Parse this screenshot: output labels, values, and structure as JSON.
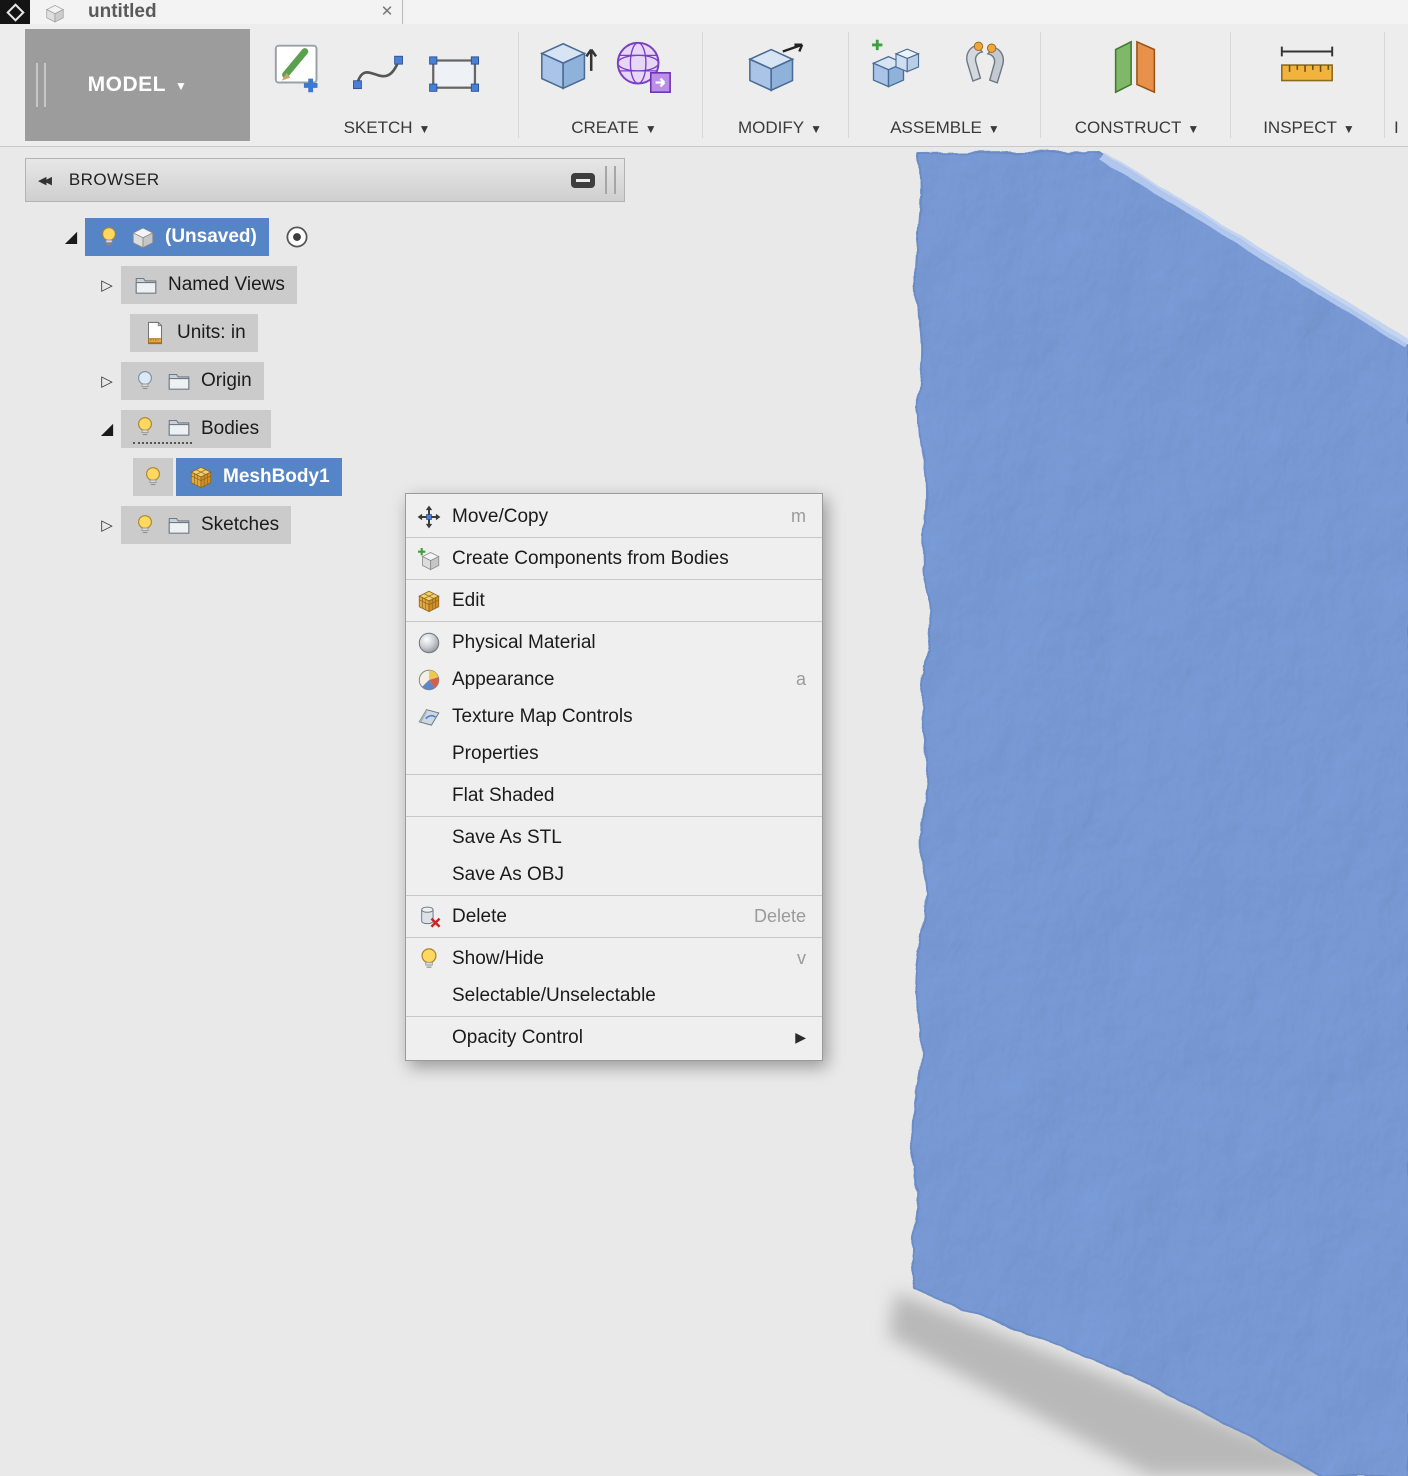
{
  "window": {
    "tab_title": "untitled"
  },
  "glyphs": {
    "close": "✕",
    "caret": "▼",
    "tri_collapsed": "▷",
    "tri_expanded": "◢",
    "collapse_panel": "◀◀",
    "submenu_arrow": "▶"
  },
  "toolbar": {
    "model_label": "MODEL",
    "trailing_partial": "I",
    "groups": [
      {
        "label": "SKETCH"
      },
      {
        "label": "CREATE"
      },
      {
        "label": "MODIFY"
      },
      {
        "label": "ASSEMBLE"
      },
      {
        "label": "CONSTRUCT"
      },
      {
        "label": "INSPECT"
      }
    ]
  },
  "browser": {
    "title": "BROWSER",
    "rows": [
      {
        "label": "(Unsaved)",
        "selected": true
      },
      {
        "label": "Named Views"
      },
      {
        "label": "Units: in"
      },
      {
        "label": "Origin"
      },
      {
        "label": "Bodies"
      },
      {
        "label": "MeshBody1",
        "selected": true
      },
      {
        "label": "Sketches"
      }
    ]
  },
  "context_menu": {
    "items": [
      {
        "label": "Move/Copy",
        "shortcut": "m"
      },
      {
        "label": "Create Components from Bodies",
        "shortcut": ""
      },
      {
        "label": "Edit",
        "shortcut": ""
      },
      {
        "label": "Physical Material",
        "shortcut": ""
      },
      {
        "label": "Appearance",
        "shortcut": "a"
      },
      {
        "label": "Texture Map Controls",
        "shortcut": ""
      },
      {
        "label": "Properties",
        "shortcut": ""
      },
      {
        "label": "Flat Shaded",
        "shortcut": ""
      },
      {
        "label": "Save As STL",
        "shortcut": ""
      },
      {
        "label": "Save As OBJ",
        "shortcut": ""
      },
      {
        "label": "Delete",
        "shortcut": "Delete"
      },
      {
        "label": "Show/Hide",
        "shortcut": "v"
      },
      {
        "label": "Selectable/Unselectable",
        "shortcut": ""
      },
      {
        "label": "Opacity Control",
        "shortcut": ""
      }
    ]
  },
  "colors": {
    "selection_blue": "#5585c7",
    "mesh_blue": "#7a9cd9",
    "accent_orange": "#f0a63c"
  }
}
